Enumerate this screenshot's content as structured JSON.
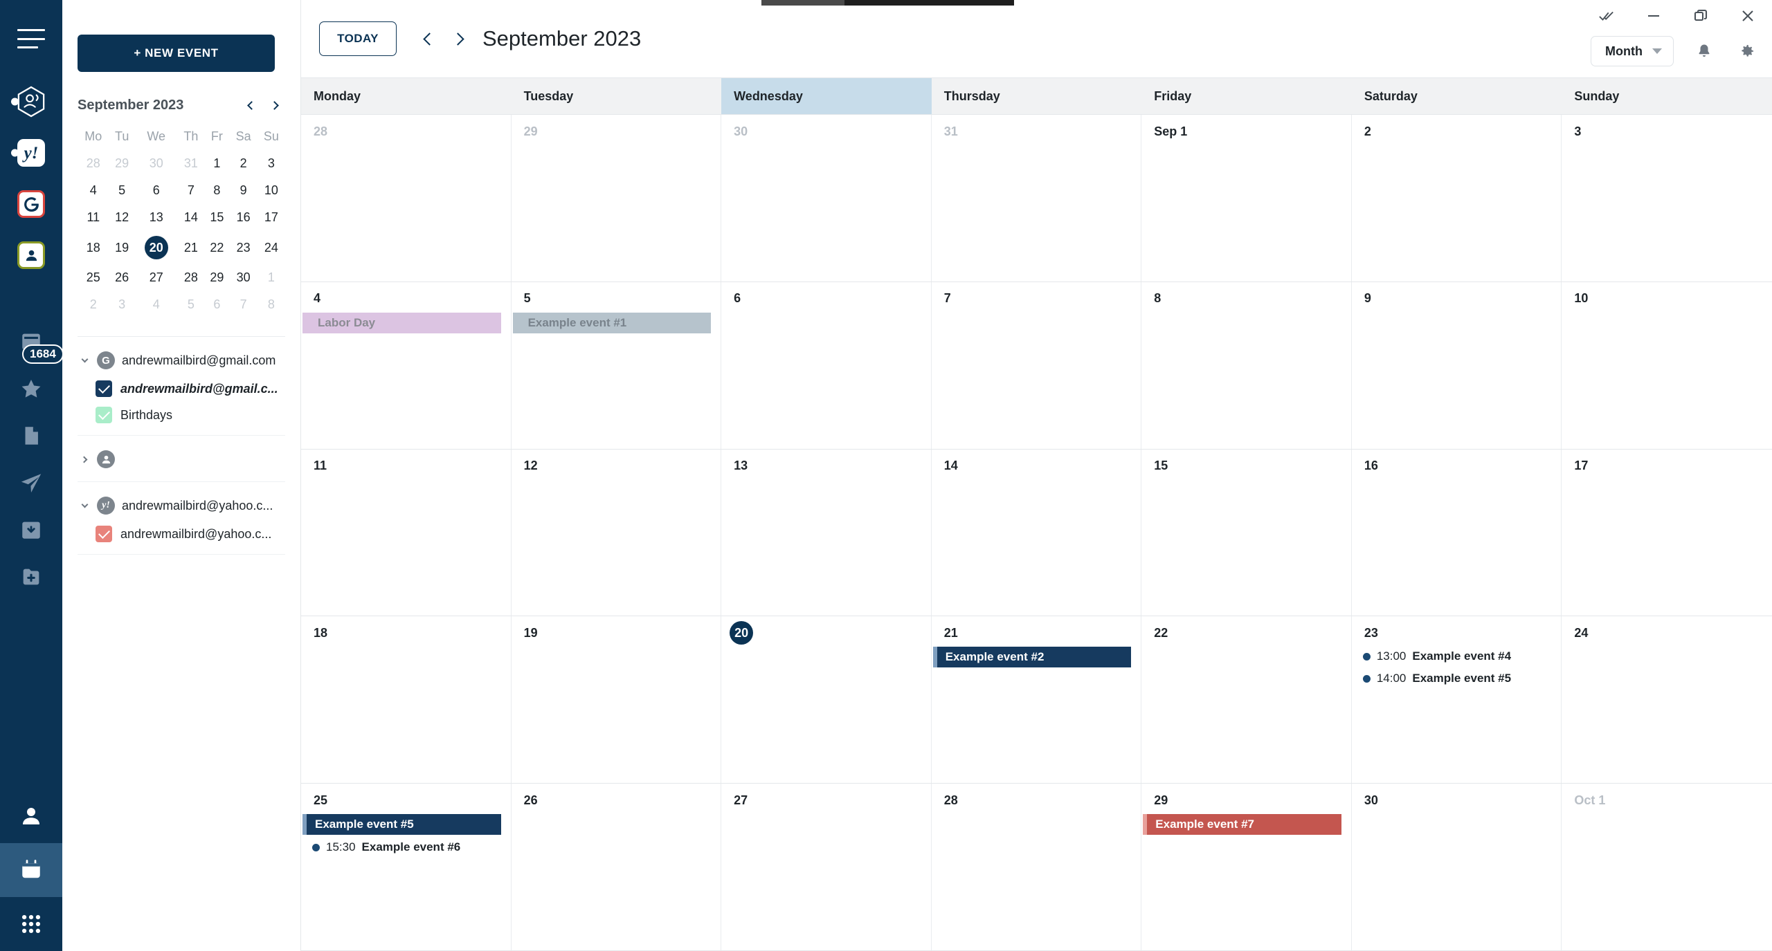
{
  "rail": {
    "hamburger_label": "menu",
    "accounts": [
      {
        "name": "mailbird-account",
        "icon": "hexagon-contact-icon",
        "unread_dot": true
      },
      {
        "name": "yahoo-account",
        "icon": "yahoo-icon",
        "glyph": "y!",
        "unread_dot": true
      },
      {
        "name": "google-account",
        "icon": "google-icon",
        "glyph": "G",
        "unread_dot": false
      },
      {
        "name": "contacts-account",
        "icon": "person-icon",
        "unread_dot": false
      }
    ],
    "folders": [
      {
        "name": "inbox",
        "icon": "inbox-icon",
        "count": "1684"
      },
      {
        "name": "starred",
        "icon": "star-icon",
        "count": ""
      },
      {
        "name": "drafts",
        "icon": "draft-file-icon",
        "count": ""
      },
      {
        "name": "sent",
        "icon": "paper-plane-icon",
        "count": ""
      },
      {
        "name": "archive",
        "icon": "archive-down-arrow-icon",
        "count": ""
      },
      {
        "name": "new-folder",
        "icon": "folder-plus-icon",
        "count": ""
      }
    ],
    "bottom": [
      {
        "name": "contacts",
        "icon": "person-icon",
        "active": false
      },
      {
        "name": "calendar",
        "icon": "calendar-icon",
        "active": true
      },
      {
        "name": "apps",
        "icon": "apps-grid-icon",
        "active": false
      }
    ]
  },
  "left_panel": {
    "new_event_label": "+ NEW EVENT",
    "mini_calendar": {
      "title": "September 2023",
      "weekday_headers": [
        "Mo",
        "Tu",
        "We",
        "Th",
        "Fr",
        "Sa",
        "Su"
      ],
      "weeks": [
        [
          {
            "d": "28",
            "out": true
          },
          {
            "d": "29",
            "out": true
          },
          {
            "d": "30",
            "out": true
          },
          {
            "d": "31",
            "out": true
          },
          {
            "d": "1",
            "out": false
          },
          {
            "d": "2",
            "out": false
          },
          {
            "d": "3",
            "out": false
          }
        ],
        [
          {
            "d": "4",
            "out": false
          },
          {
            "d": "5",
            "out": false
          },
          {
            "d": "6",
            "out": false
          },
          {
            "d": "7",
            "out": false
          },
          {
            "d": "8",
            "out": false
          },
          {
            "d": "9",
            "out": false
          },
          {
            "d": "10",
            "out": false
          }
        ],
        [
          {
            "d": "11",
            "out": false
          },
          {
            "d": "12",
            "out": false
          },
          {
            "d": "13",
            "out": false
          },
          {
            "d": "14",
            "out": false
          },
          {
            "d": "15",
            "out": false
          },
          {
            "d": "16",
            "out": false
          },
          {
            "d": "17",
            "out": false
          }
        ],
        [
          {
            "d": "18",
            "out": false
          },
          {
            "d": "19",
            "out": false
          },
          {
            "d": "20",
            "out": false,
            "selected": true
          },
          {
            "d": "21",
            "out": false
          },
          {
            "d": "22",
            "out": false
          },
          {
            "d": "23",
            "out": false
          },
          {
            "d": "24",
            "out": false
          }
        ],
        [
          {
            "d": "25",
            "out": false
          },
          {
            "d": "26",
            "out": false
          },
          {
            "d": "27",
            "out": false
          },
          {
            "d": "28",
            "out": false
          },
          {
            "d": "29",
            "out": false
          },
          {
            "d": "30",
            "out": false
          },
          {
            "d": "1",
            "out": true
          }
        ],
        [
          {
            "d": "2",
            "out": true
          },
          {
            "d": "3",
            "out": true
          },
          {
            "d": "4",
            "out": true
          },
          {
            "d": "5",
            "out": true
          },
          {
            "d": "6",
            "out": true
          },
          {
            "d": "7",
            "out": true
          },
          {
            "d": "8",
            "out": true
          }
        ]
      ]
    },
    "accounts": [
      {
        "name": "andrewmailbird@gmail.com",
        "avatar_glyph": "G",
        "avatar_type": "google",
        "expanded": true,
        "calendars": [
          {
            "label": "andrewmailbird@gmail.c...",
            "color": "navy",
            "checked": true,
            "selected": true
          },
          {
            "label": "Birthdays",
            "color": "mint",
            "checked": true,
            "selected": false
          }
        ]
      },
      {
        "name": "",
        "avatar_glyph": "",
        "avatar_type": "person",
        "expanded": false,
        "calendars": []
      },
      {
        "name": "andrewmailbird@yahoo.c...",
        "avatar_glyph": "y!",
        "avatar_type": "yahoo",
        "expanded": true,
        "calendars": [
          {
            "label": "andrewmailbird@yahoo.c...",
            "color": "red",
            "checked": true,
            "selected": false
          }
        ]
      }
    ]
  },
  "toolbar": {
    "today_label": "TODAY",
    "prev_label": "previous month",
    "next_label": "next month",
    "title": "September 2023",
    "view_selected": "Month",
    "window_buttons": [
      "mark-all-read-icon",
      "minimize-icon",
      "restore-icon",
      "close-icon"
    ]
  },
  "calendar": {
    "weekday_headers": [
      "Monday",
      "Tuesday",
      "Wednesday",
      "Thursday",
      "Friday",
      "Saturday",
      "Sunday"
    ],
    "today_column_index": 2,
    "weeks": [
      [
        {
          "label": "28",
          "out": true,
          "events": []
        },
        {
          "label": "29",
          "out": true,
          "events": []
        },
        {
          "label": "30",
          "out": true,
          "events": []
        },
        {
          "label": "31",
          "out": true,
          "events": []
        },
        {
          "label": "Sep 1",
          "out": false,
          "events": []
        },
        {
          "label": "2",
          "out": false,
          "events": []
        },
        {
          "label": "3",
          "out": false,
          "events": []
        }
      ],
      [
        {
          "label": "4",
          "out": false,
          "events": [
            {
              "kind": "block",
              "style": "lilac",
              "title": "Labor Day"
            }
          ]
        },
        {
          "label": "5",
          "out": false,
          "events": [
            {
              "kind": "block",
              "style": "slate",
              "title": "Example event #1"
            }
          ]
        },
        {
          "label": "6",
          "out": false,
          "events": []
        },
        {
          "label": "7",
          "out": false,
          "events": []
        },
        {
          "label": "8",
          "out": false,
          "events": []
        },
        {
          "label": "9",
          "out": false,
          "events": []
        },
        {
          "label": "10",
          "out": false,
          "events": []
        }
      ],
      [
        {
          "label": "11",
          "out": false,
          "events": []
        },
        {
          "label": "12",
          "out": false,
          "events": []
        },
        {
          "label": "13",
          "out": false,
          "events": []
        },
        {
          "label": "14",
          "out": false,
          "events": []
        },
        {
          "label": "15",
          "out": false,
          "events": []
        },
        {
          "label": "16",
          "out": false,
          "events": []
        },
        {
          "label": "17",
          "out": false,
          "events": []
        }
      ],
      [
        {
          "label": "18",
          "out": false,
          "events": []
        },
        {
          "label": "19",
          "out": false,
          "events": []
        },
        {
          "label": "20",
          "out": false,
          "today": true,
          "events": []
        },
        {
          "label": "21",
          "out": false,
          "events": [
            {
              "kind": "block",
              "style": "navy",
              "title": "Example event #2"
            }
          ]
        },
        {
          "label": "22",
          "out": false,
          "events": []
        },
        {
          "label": "23",
          "out": false,
          "events": [
            {
              "kind": "timed",
              "time": "13:00",
              "title": "Example event #4"
            },
            {
              "kind": "timed",
              "time": "14:00",
              "title": "Example event #5"
            }
          ]
        },
        {
          "label": "24",
          "out": false,
          "events": []
        }
      ],
      [
        {
          "label": "25",
          "out": false,
          "events": [
            {
              "kind": "block",
              "style": "navy",
              "title": "Example event #5"
            },
            {
              "kind": "timed",
              "time": "15:30",
              "title": "Example event #6"
            }
          ]
        },
        {
          "label": "26",
          "out": false,
          "events": []
        },
        {
          "label": "27",
          "out": false,
          "events": []
        },
        {
          "label": "28",
          "out": false,
          "events": []
        },
        {
          "label": "29",
          "out": false,
          "events": [
            {
              "kind": "block",
              "style": "red",
              "title": "Example event #7"
            }
          ]
        },
        {
          "label": "30",
          "out": false,
          "events": []
        },
        {
          "label": "Oct 1",
          "out": true,
          "events": []
        }
      ]
    ]
  },
  "colors": {
    "brand_navy": "#0b3354",
    "event_navy": "#163a5f",
    "event_red": "#c4564f",
    "event_lilac": "#dcc4e2",
    "event_slate": "#b6c3cc",
    "today_column": "#c7dcea",
    "header_bg": "#f1f2f3"
  }
}
